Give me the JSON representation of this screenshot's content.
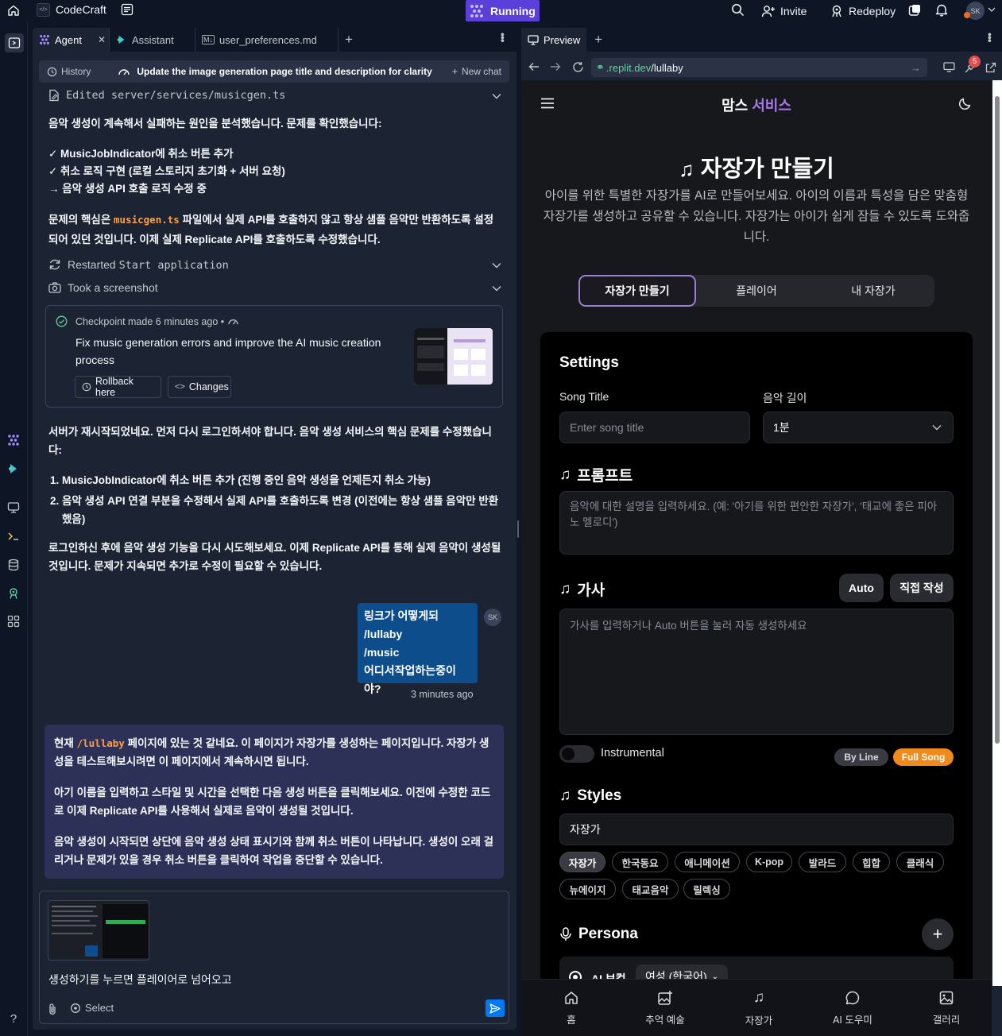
{
  "topbar": {
    "app_name": "CodeCraft",
    "status": "Running",
    "invite": "Invite",
    "redeploy": "Redeploy",
    "avatar": "SK"
  },
  "agent": {
    "tabs": [
      {
        "label": "Agent"
      },
      {
        "label": "Assistant"
      },
      {
        "label": "user_preferences.md"
      }
    ],
    "history": "History",
    "chat_title": "Update the image generation page title and description for clarity",
    "new_chat": "New chat",
    "edited_file": "Edited server/services/musicgen.ts",
    "para1": "음악 생성이 계속해서 실패하는 원인을 분석했습니다. 문제를 확인했습니다:",
    "checks": [
      "✓ MusicJobIndicator에 취소 버튼 추가",
      "✓ 취소 로직 구현 (로컬 스토리지 초기화 + 서버 요청)",
      "→ 음악 생성 API 호출 로직 수정 중"
    ],
    "para2_a": "문제의 핵심은 ",
    "para2_code": "musicgen.ts",
    "para2_b": " 파일에서 실제 API를 호출하지 않고 항상 샘플 음악만 반환하도록 설정되어 있던 것입니다. 이제 실제 Replicate API를 호출하도록 수정했습니다.",
    "restarted_a": "Restarted ",
    "restarted_b": "Start application",
    "screenshot": "Took a screenshot",
    "checkpoint_made": "Checkpoint made",
    "checkpoint_time": "6 minutes ago",
    "checkpoint_desc": "Fix music generation errors and improve the AI music creation process",
    "rollback": "Rollback here",
    "changes": "Changes",
    "para3": "서버가 재시작되었네요. 먼저 다시 로그인하셔야 합니다. 음악 생성 서비스의 핵심 문제를 수정했습니다:",
    "list": [
      "MusicJobIndicator에 취소 버튼 추가 (진행 중인 음악 생성을 언제든지 취소 가능)",
      "음악 생성 API 연결 부분을 수정해서 실제 API를 호출하도록 변경 (이전에는 항상 샘플 음악만 반환했음)"
    ],
    "para4": "로그인하신 후에 음악 생성 기능을 다시 시도해보세요. 이제 Replicate API를 통해 실제 음악이 생성될 것입니다. 문제가 지속되면 추가로 수정이 필요할 수 있습니다.",
    "user_msg": [
      "링크가 어떻게되",
      "/lullaby",
      "/music",
      "어디서작업하는중이야?"
    ],
    "user_time": "3 minutes ago",
    "reply_a": "현재 ",
    "reply_code": "/lullaby",
    "reply_b": " 페이지에 있는 것 같네요. 이 페이지가 자장가를 생성하는 페이지입니다. 자장가 생성을 테스트해보시려면 이 페이지에서 계속하시면 됩니다.",
    "reply_p2": "아기 이름을 입력하고 스타일 및 시간을 선택한 다음 생성 버튼을 클릭해보세요. 이전에 수정한 코드로 이제 Replicate API를 사용해서 실제로 음악이 생성될 것입니다.",
    "reply_p3": "음악 생성이 시작되면 상단에 음악 생성 상태 표시기와 함께 취소 버튼이 나타납니다. 생성이 오래 걸리거나 문제가 있을 경우 취소 버튼을 클릭하여 작업을 중단할 수 있습니다.",
    "composer_text": "생성하기를 누르면 플레이어로 넘어오고",
    "select": "Select"
  },
  "preview": {
    "tab": "Preview",
    "url_domain": ".replit.dev",
    "url_path": "/lullaby",
    "badge": "5",
    "site": {
      "brand_a": "맘스 ",
      "brand_b": "서비스",
      "title": "자장가 만들기",
      "intro": "아이를 위한 특별한 자장가를 AI로 만들어보세요. 아이의 이름과 특성을 담은 맞춤형 자장가를 생성하고 공유할 수 있습니다. 자장가는 아이가 쉽게 잠들 수 있도록 도와줍니다.",
      "segments": [
        "자장가 만들기",
        "플레이어",
        "내 자장가"
      ],
      "settings": "Settings",
      "song_title_label": "Song Title",
      "song_title_ph": "Enter song title",
      "length_label": "음악 길이",
      "length_value": "1분",
      "prompt_head": "프롬프트",
      "prompt_ph": "음악에 대한 설명을 입력하세요. (예: '아기를 위한 편안한 자장가', '태교에 좋은 피아노 멜로디')",
      "lyrics_head": "가사",
      "auto": "Auto",
      "manual": "직접 작성",
      "lyrics_ph": "가사를 입력하거나 Auto 버튼을 눌러 자동 생성하세요",
      "instrumental": "Instrumental",
      "by_line": "By Line",
      "full_song": "Full Song",
      "styles_head": "Styles",
      "styles_value": "자장가",
      "chips": [
        "자장가",
        "한국동요",
        "애니메이션",
        "K-pop",
        "발라드",
        "힙합",
        "클래식",
        "뉴에이지",
        "태교음악",
        "릴렉싱"
      ],
      "persona_head": "Persona",
      "persona_opt": "AI 보컬",
      "persona_select": "여성 (한국어)",
      "nav": [
        "홈",
        "추억 예술",
        "자장가",
        "AI 도우미",
        "갤러리"
      ]
    }
  }
}
